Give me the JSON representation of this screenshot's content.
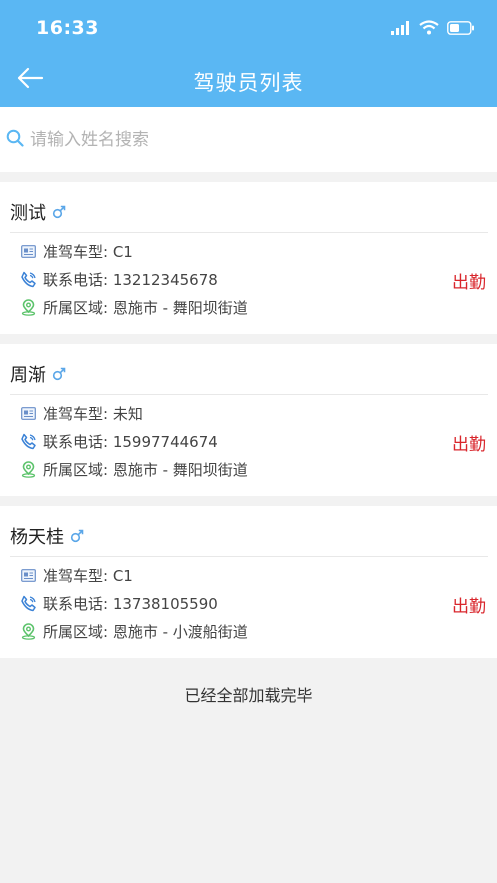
{
  "status_bar": {
    "time": "16:33"
  },
  "nav": {
    "title": "驾驶员列表"
  },
  "search": {
    "placeholder": "请输入姓名搜索"
  },
  "drivers": [
    {
      "name": "测试",
      "license_label": "准驾车型: C1",
      "phone_label": "联系电话: 13212345678",
      "area_label": "所属区域: 恩施市 - 舞阳坝街道",
      "action": "出勤"
    },
    {
      "name": "周渐",
      "license_label": "准驾车型: 未知",
      "phone_label": "联系电话: 15997744674",
      "area_label": "所属区域: 恩施市 - 舞阳坝街道",
      "action": "出勤"
    },
    {
      "name": "杨天桂",
      "license_label": "准驾车型: C1",
      "phone_label": "联系电话: 13738105590",
      "area_label": "所属区域: 恩施市 - 小渡船街道",
      "action": "出勤"
    }
  ],
  "footer": {
    "text": "已经全部加载完毕"
  },
  "colors": {
    "brand": "#5ab7f3",
    "action": "#d9262c",
    "gender": "#5aa6e8",
    "location": "#5cc36b"
  }
}
